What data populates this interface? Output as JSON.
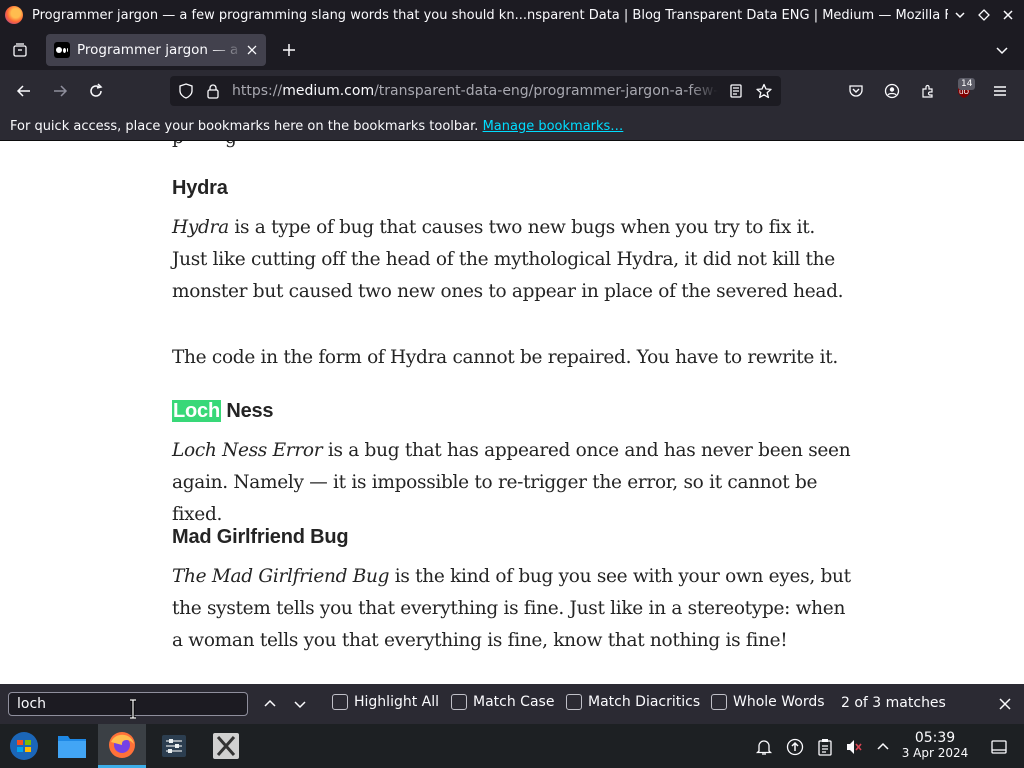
{
  "window": {
    "title": "Programmer jargon — a few programming slang words that you should kn...nsparent Data | Blog Transparent Data ENG | Medium — Mozilla Firefox"
  },
  "tab": {
    "title": "Programmer jargon — a few programming slang words"
  },
  "urlbar": {
    "scheme": "https://",
    "host": "medium.com",
    "path": "/transparent-data-eng/programmer-jargon-a-few-"
  },
  "toolbar": {
    "extension_badge": "14"
  },
  "bookmarks_bar": {
    "message": "For quick access, place your bookmarks here on the bookmarks toolbar.",
    "link": "Manage bookmarks…"
  },
  "article": {
    "hydra": {
      "heading": "Hydra",
      "p1_term": "Hydra",
      "p1_rest": " is a type of bug that causes two new bugs when you try to fix it. Just like cutting off the head of the mythological Hydra, it did not kill the monster but caused two new ones to appear in place of the severed head.",
      "p2": "The code in the form of Hydra cannot be repaired. You have to rewrite it."
    },
    "loch_ness": {
      "heading_highlight": "Loch",
      "heading_rest": " Ness",
      "p_term": "Loch Ness Error",
      "p_rest": " is a bug that has appeared once and has never been seen again. Namely — it is impossible to re-trigger the error, so it cannot be fixed."
    },
    "mad_girlfriend": {
      "heading": "Mad Girlfriend Bug",
      "p_term": "The Mad Girlfriend Bug",
      "p_rest": " is the kind of bug you see with your own eyes, but the system tells you that everything is fine. Just like in a stereotype: when a woman tells you that everything is fine, know that nothing is fine!"
    }
  },
  "findbar": {
    "query": "loch",
    "highlight_all": "Highlight All",
    "match_case": "Match Case",
    "match_diacritics": "Match Diacritics",
    "whole_words": "Whole Words",
    "status": "2 of 3 matches"
  },
  "taskbar": {
    "time": "05:39",
    "date": "3 Apr 2024"
  },
  "colors": {
    "highlight": "#38d878",
    "link": "#00ddff",
    "chrome_dark": "#1c1b22",
    "chrome": "#2b2a33"
  }
}
